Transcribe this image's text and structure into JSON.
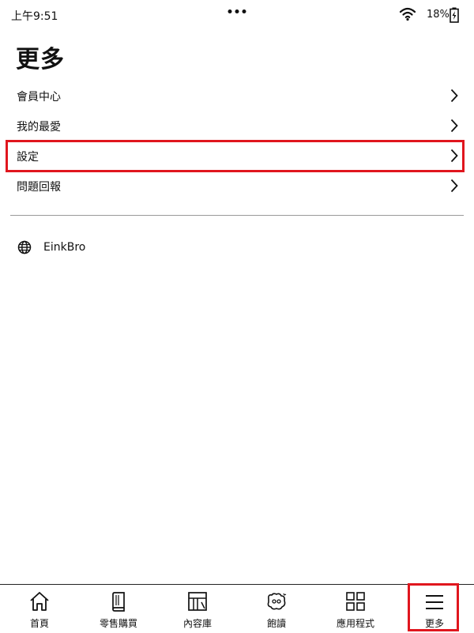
{
  "status_bar": {
    "time": "上午9:51",
    "battery": "18%",
    "icons": [
      "more-dots-icon",
      "wifi-icon",
      "battery-charging-icon"
    ]
  },
  "page": {
    "title": "更多"
  },
  "menu": {
    "items": [
      {
        "label": "會員中心",
        "icon": "chevron-right-icon"
      },
      {
        "label": "我的最愛",
        "icon": "chevron-right-icon"
      },
      {
        "label": "設定",
        "icon": "chevron-right-icon",
        "highlighted": true
      },
      {
        "label": "問題回報",
        "icon": "chevron-right-icon"
      }
    ]
  },
  "apps": [
    {
      "label": "EinkBro",
      "icon": "globe-icon"
    }
  ],
  "bottom_nav": {
    "items": [
      {
        "label": "首頁",
        "icon": "home-icon"
      },
      {
        "label": "零售購買",
        "icon": "book-icon"
      },
      {
        "label": "內容庫",
        "icon": "library-icon"
      },
      {
        "label": "飽讀",
        "icon": "subscription-icon"
      },
      {
        "label": "應用程式",
        "icon": "apps-grid-icon"
      },
      {
        "label": "更多",
        "icon": "hamburger-menu-icon",
        "selected": true
      }
    ]
  },
  "colors": {
    "highlight": "#e0161e",
    "text": "#111111",
    "divider": "#9a9a9a"
  }
}
